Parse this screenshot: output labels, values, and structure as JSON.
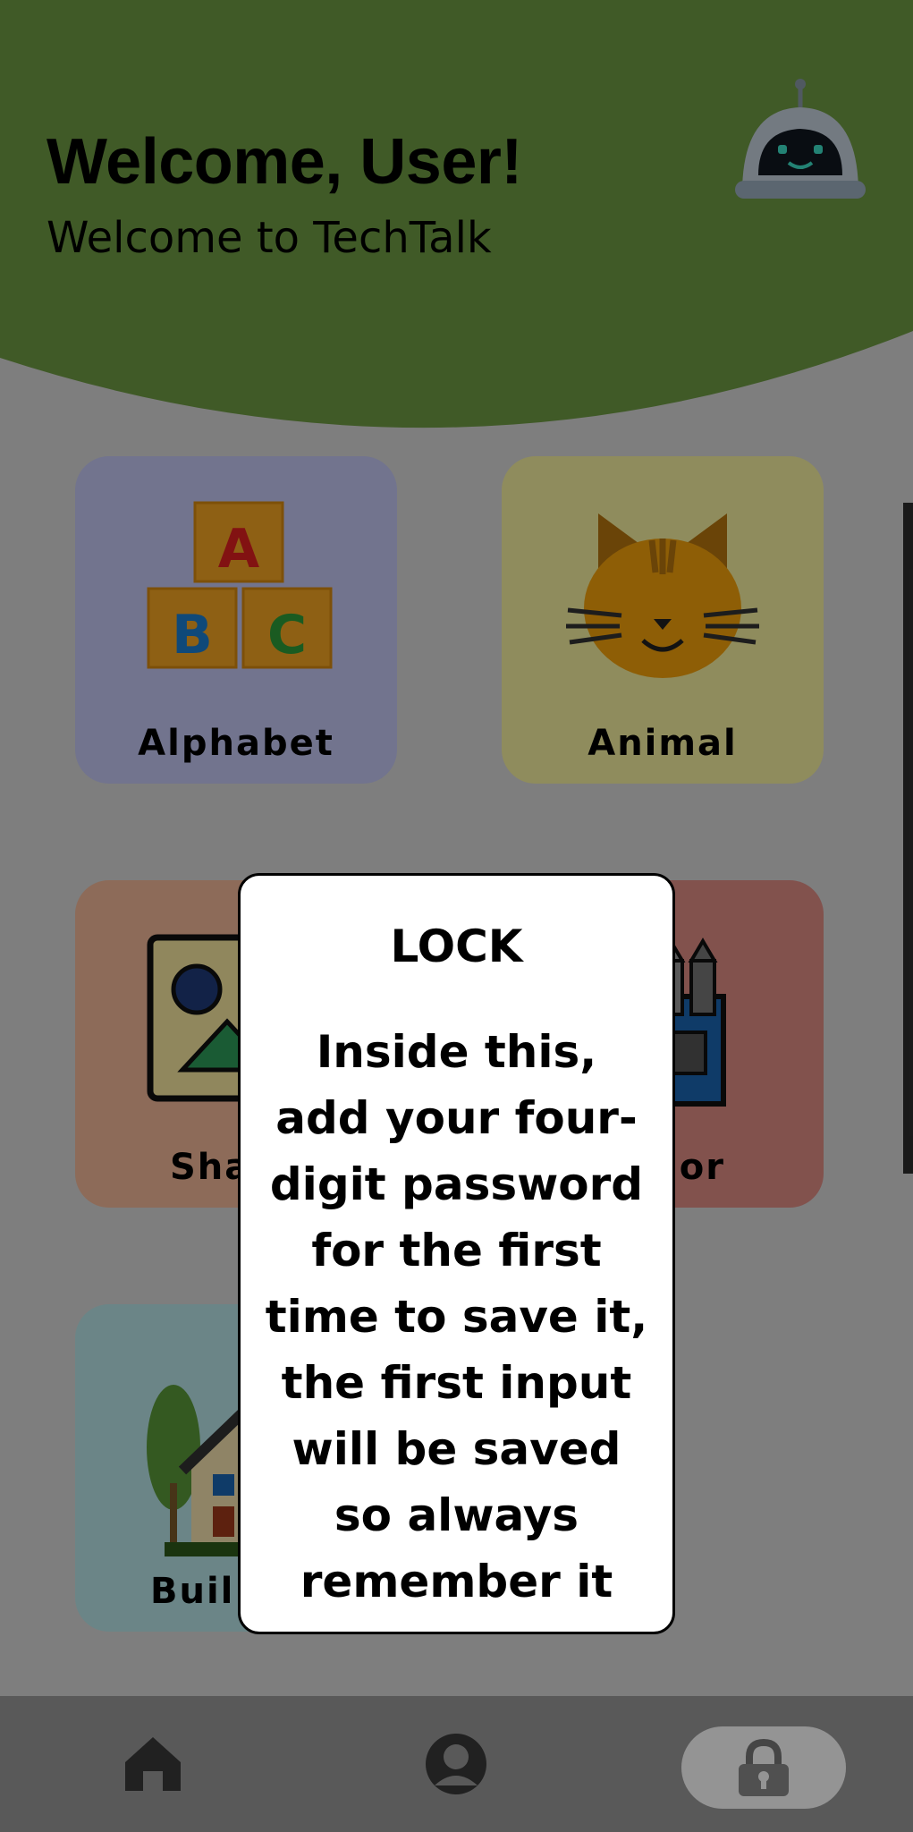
{
  "header": {
    "title": "Welcome, User!",
    "subtitle": "Welcome to TechTalk",
    "mascot_icon": "robot-icon",
    "color": "#6e9b44"
  },
  "categories": [
    {
      "label": "Alphabet",
      "icon": "abc-blocks-icon",
      "color": "#c4c8f5"
    },
    {
      "label": "Animal",
      "icon": "cat-icon",
      "color": "#f7f1a0"
    },
    {
      "label": "Sha",
      "icon": "shapes-icon",
      "color": "#f3b99a"
    },
    {
      "label": "lor",
      "icon": "crayons-icon",
      "color": "#e08d86"
    },
    {
      "label": "Buil",
      "icon": "house-icon",
      "color": "#b9e6e8"
    }
  ],
  "modal": {
    "title": "LOCK",
    "body": "Inside this, add your four-digit password for the first time to save it, the first input will be saved so always remember it"
  },
  "nav": {
    "items": [
      {
        "name": "home",
        "icon": "home-icon",
        "active": false
      },
      {
        "name": "profile",
        "icon": "user-icon",
        "active": false
      },
      {
        "name": "lock",
        "icon": "lock-icon",
        "active": true
      }
    ]
  }
}
